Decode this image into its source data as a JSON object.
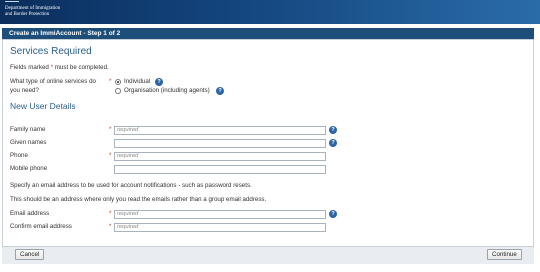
{
  "brand": {
    "line1": "Department of Immigration",
    "line2": "and Border Protection"
  },
  "header": {
    "title": "Create an ImmiAccount - Step 1 of 2"
  },
  "section1": {
    "title": "Services Required",
    "fields_marked_prefix": "Fields marked",
    "fields_marked_star": "*",
    "fields_marked_suffix": "must be completed.",
    "question_line1": "What type of online services do",
    "question_line2": "you need?",
    "options": [
      {
        "label": "Individual",
        "selected": true
      },
      {
        "label": "Organisation (including agents)",
        "selected": false
      }
    ]
  },
  "section2": {
    "title": "New User Details",
    "rows": {
      "family_name": {
        "label": "Family name",
        "required": true,
        "value": "",
        "placeholder": "required"
      },
      "given_names": {
        "label": "Given names",
        "required": false,
        "value": "",
        "placeholder": ""
      },
      "phone": {
        "label": "Phone",
        "required": true,
        "value": "",
        "placeholder": "required"
      },
      "mobile_phone": {
        "label": "Mobile phone",
        "required": false,
        "value": "",
        "placeholder": ""
      }
    },
    "notice1": "Specify an email address to be used for account notifications - such as password resets.",
    "notice2": "This should be an address where only you read the emails rather than a group email address.",
    "email_rows": {
      "email": {
        "label": "Email address",
        "required": true,
        "value": "",
        "placeholder": "required"
      },
      "confirm_email": {
        "label": "Confirm email address",
        "required": true,
        "value": "",
        "placeholder": "required"
      }
    }
  },
  "footer": {
    "cancel_label": "Cancel",
    "continue_label": "Continue"
  },
  "icons": {
    "help": "help-icon",
    "required": "required-star"
  },
  "colors": {
    "header_bg": "#1d4e7a",
    "title_blue": "#2b5f8d",
    "help_icon": "#2b66a7",
    "required_star": "#c0392b"
  }
}
